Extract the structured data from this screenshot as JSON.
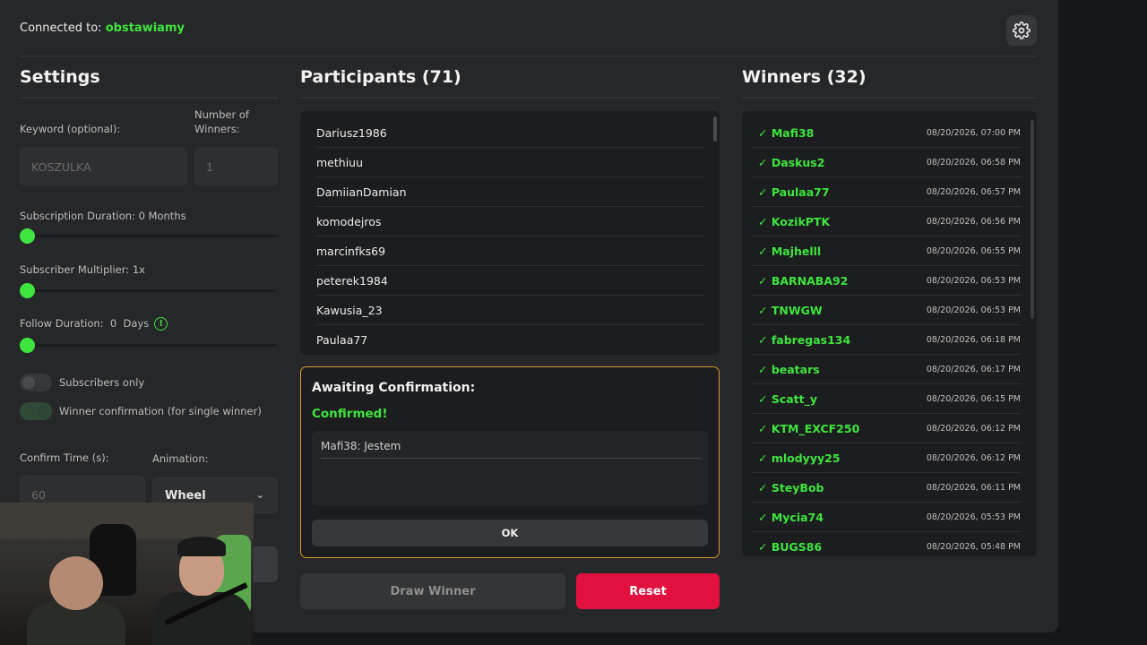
{
  "header": {
    "connected_label": "Connected to:",
    "channel": "obstawiamy"
  },
  "settings": {
    "title": "Settings",
    "keyword_label": "Keyword (optional):",
    "keyword_placeholder": "KOSZULKA",
    "winners_label_1": "Number of",
    "winners_label_2": "Winners:",
    "winners_value": "1",
    "sub_duration_label": "Subscription Duration: 0 Months",
    "sub_multiplier_label": "Subscriber Multiplier: 1x",
    "follow_label": "Follow Duration:  0  Days",
    "subs_only_label": "Subscribers only",
    "winner_confirm_label": "Winner confirmation (for single winner)",
    "confirm_time_label": "Confirm Time (s):",
    "confirm_time_value": "60",
    "animation_label": "Animation:",
    "animation_value": "Wheel"
  },
  "participants": {
    "title": "Participants (71)",
    "items": [
      "Dariusz1986",
      "methiuu",
      "DamiianDamian",
      "komodejros",
      "marcinfks69",
      "peterek1984",
      "Kawusia_23",
      "Paulaa77"
    ]
  },
  "confirmation": {
    "title": "Awaiting Confirmation:",
    "status": "Confirmed!",
    "message": "Mafi38: Jestem",
    "ok_label": "OK"
  },
  "actions": {
    "draw_label": "Draw Winner",
    "reset_label": "Reset"
  },
  "winners": {
    "title": "Winners (32)",
    "items": [
      {
        "name": "✓ Mafi38",
        "time": "08/20/2026, 07:00 PM"
      },
      {
        "name": "✓ Daskus2",
        "time": "08/20/2026, 06:58 PM"
      },
      {
        "name": "✓ Paulaa77",
        "time": "08/20/2026, 06:57 PM"
      },
      {
        "name": "✓ KozikPTK",
        "time": "08/20/2026, 06:56 PM"
      },
      {
        "name": "✓ Majhelll",
        "time": "08/20/2026, 06:55 PM"
      },
      {
        "name": "✓ BARNABA92",
        "time": "08/20/2026, 06:53 PM"
      },
      {
        "name": "✓ TNWGW",
        "time": "08/20/2026, 06:53 PM"
      },
      {
        "name": "✓ fabregas134",
        "time": "08/20/2026, 06:18 PM"
      },
      {
        "name": "✓ beatars",
        "time": "08/20/2026, 06:17 PM"
      },
      {
        "name": "✓ Scatt_y",
        "time": "08/20/2026, 06:15 PM"
      },
      {
        "name": "✓ KTM_EXCF250",
        "time": "08/20/2026, 06:12 PM"
      },
      {
        "name": "✓ mlodyyy25",
        "time": "08/20/2026, 06:12 PM"
      },
      {
        "name": "✓ SteyBob",
        "time": "08/20/2026, 06:11 PM"
      },
      {
        "name": "✓ Mycia74",
        "time": "08/20/2026, 05:53 PM"
      },
      {
        "name": "✓ BUGS86",
        "time": "08/20/2026, 05:48 PM"
      }
    ]
  },
  "colors": {
    "accent": "#3ee53e",
    "reset": "#e1103e",
    "confirm_border": "#d69a2a"
  },
  "icons": {
    "settings": "gear-icon",
    "info": "info-icon",
    "dropdown": "chevron-down-icon"
  }
}
